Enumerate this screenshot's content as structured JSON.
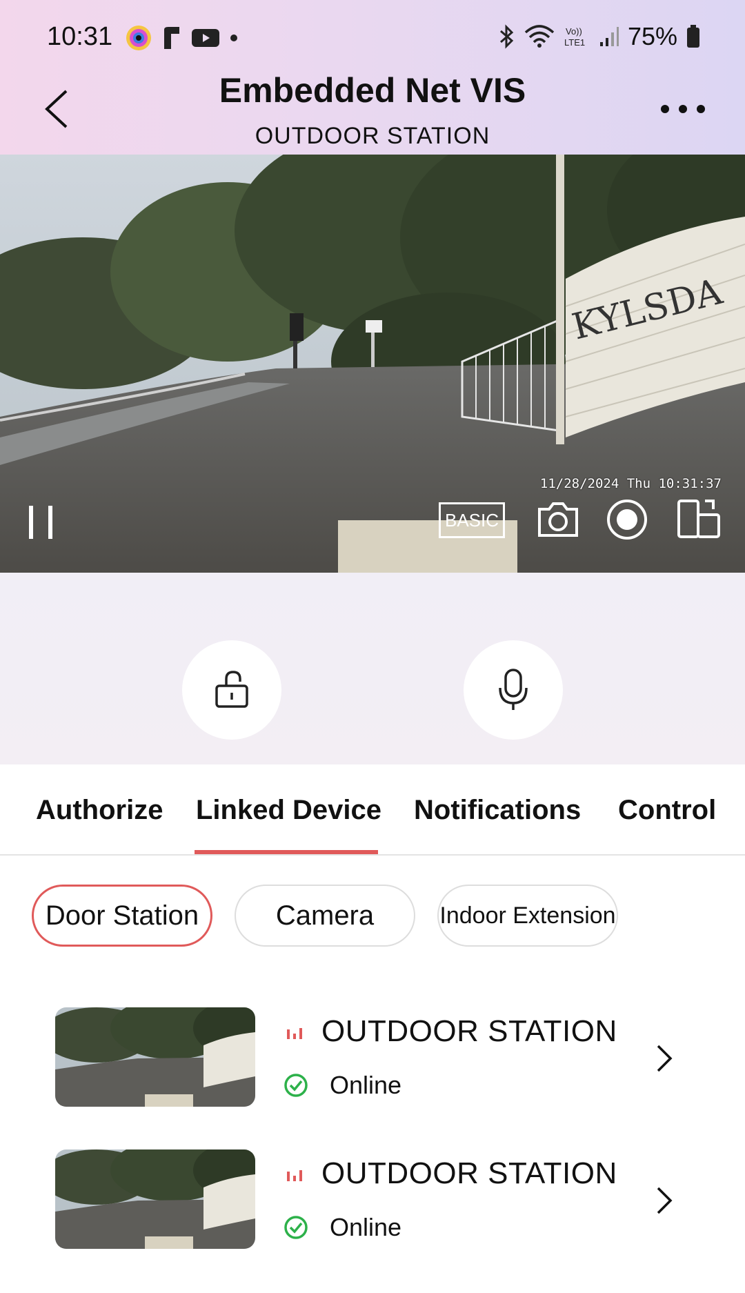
{
  "status_bar": {
    "time": "10:31",
    "battery": "75%",
    "icons": [
      "camera-app-icon",
      "r-app-icon",
      "youtube-icon",
      "dot-icon",
      "bluetooth-icon",
      "wifi-icon",
      "volte-icon",
      "signal-icon",
      "battery-icon"
    ]
  },
  "header": {
    "title": "Embedded Net VIS",
    "subtitle": "OUTDOOR STATION"
  },
  "video": {
    "timestamp": "11/28/2024 Thu 10:31:37",
    "quality_label": "BASIC",
    "overlay_sign": "KYLSDA"
  },
  "actions": {
    "unlock": "unlock-icon",
    "talk": "microphone-icon"
  },
  "tabs": [
    {
      "label": "Authorize",
      "active": false
    },
    {
      "label": "Linked Device",
      "active": true
    },
    {
      "label": "Notifications",
      "active": false
    },
    {
      "label": "Control",
      "active": false
    }
  ],
  "filters": [
    {
      "label": "Door Station",
      "active": true
    },
    {
      "label": "Camera",
      "active": false
    },
    {
      "label": "Indoor Extension",
      "active": false
    }
  ],
  "devices": [
    {
      "name": "OUTDOOR STATION",
      "status": "Online"
    },
    {
      "name": "OUTDOOR STATION",
      "status": "Online"
    }
  ],
  "colors": {
    "accent": "#e05a5a",
    "online": "#2db14a"
  }
}
